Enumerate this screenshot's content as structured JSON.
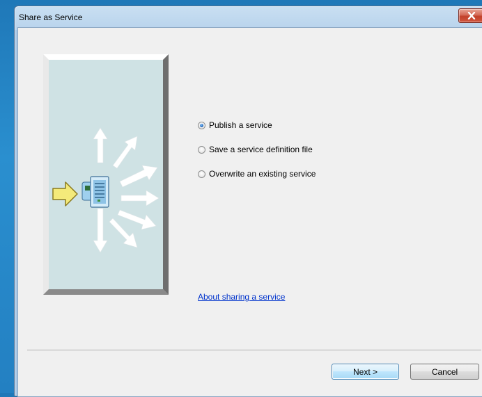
{
  "window": {
    "title": "Share as Service",
    "close_icon": "close-icon"
  },
  "illustration": {
    "icon": "service-publish-illustration",
    "arrow_icon": "yellow-arrow-right-icon",
    "server_icon": "server-icon",
    "rays_icon": "radiating-arrows-icon"
  },
  "options": [
    {
      "label": "Publish a service",
      "checked": true
    },
    {
      "label": "Save a service definition file",
      "checked": false
    },
    {
      "label": "Overwrite an existing service",
      "checked": false
    }
  ],
  "help_link": "About sharing a service",
  "buttons": {
    "next": "Next >",
    "cancel": "Cancel"
  },
  "colors": {
    "titlebar": "#b8d3ec",
    "link": "#0033cc",
    "panel": "#cfe2e4",
    "accent_arrow": "#f2e66b"
  }
}
